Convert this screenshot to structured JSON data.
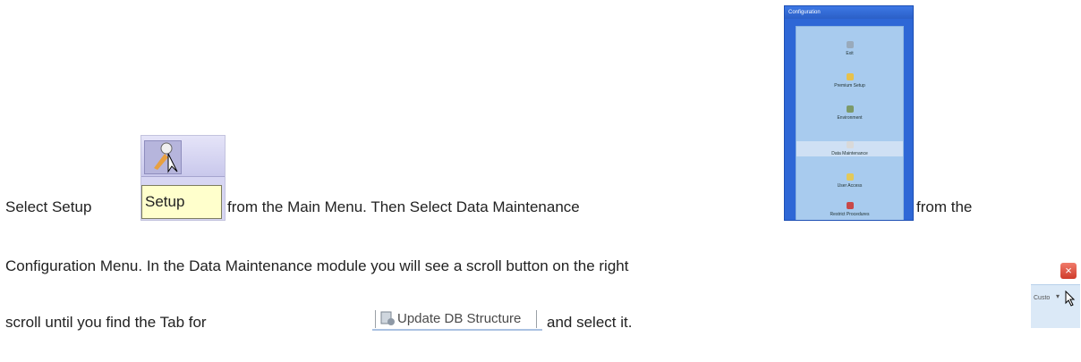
{
  "line1": {
    "select_setup": "Select Setup",
    "from_main_menu": "from the Main Menu. Then Select Data Maintenance",
    "from_the": "from the"
  },
  "line2": {
    "text": "Configuration Menu. In the Data Maintenance module you will see a scroll button on the right"
  },
  "line3": {
    "scroll_until": "scroll until you find the Tab for",
    "and_select": "and select it."
  },
  "setup_snapshot": {
    "tooltip": "Setup"
  },
  "configuration_snapshot": {
    "title": "Configuration",
    "items": [
      "Exit",
      "Premium Setup",
      "Environment",
      "Data Maintenance",
      "User Access",
      "Restrict Procedures"
    ]
  },
  "scroll_snapshot": {
    "field": "Custo"
  },
  "tab_snapshot": {
    "label": "Update DB Structure"
  },
  "colors": {
    "config_bg": "#2e67d6",
    "tooltip_bg": "#ffffcc",
    "tab_underline": "#aac2e2"
  }
}
